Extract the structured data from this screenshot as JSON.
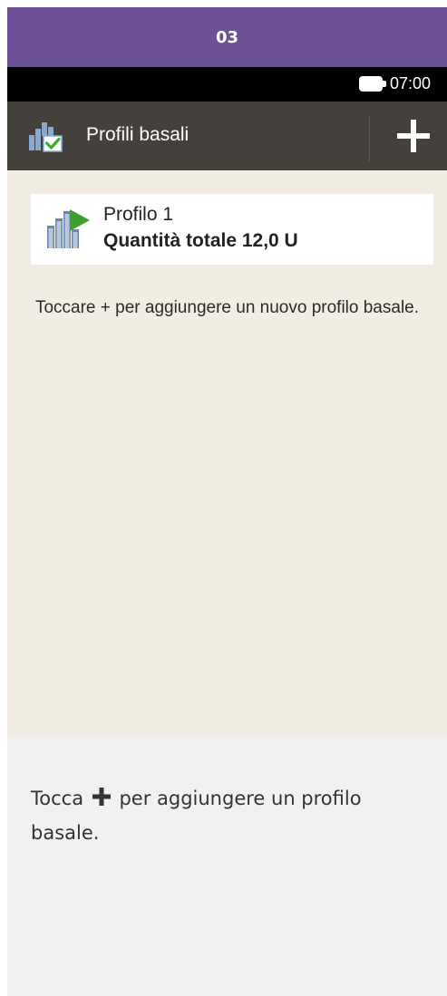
{
  "step": {
    "number": "03"
  },
  "status_bar": {
    "time": "07:00",
    "battery_icon": "battery-icon"
  },
  "title_bar": {
    "icon": "basal-profile-icon",
    "title": "Profili basali",
    "add_icon": "plus-icon"
  },
  "profiles": [
    {
      "icon": "basal-profile-active-icon",
      "name": "Profilo 1",
      "total": "Quantità totale 12,0 U"
    }
  ],
  "hint": "Toccare + per aggiungere un nuovo profilo basale.",
  "caption": {
    "before": "Tocca",
    "icon": "plus-icon",
    "after": "per aggiungere un profilo basale."
  },
  "colors": {
    "header_purple": "#6c5197",
    "title_bar": "#44403b",
    "screen_bg": "#f2ede3",
    "caption_bg": "#f1f1f1",
    "check_green": "#3bab2f",
    "flag_green": "#3ea12f"
  }
}
